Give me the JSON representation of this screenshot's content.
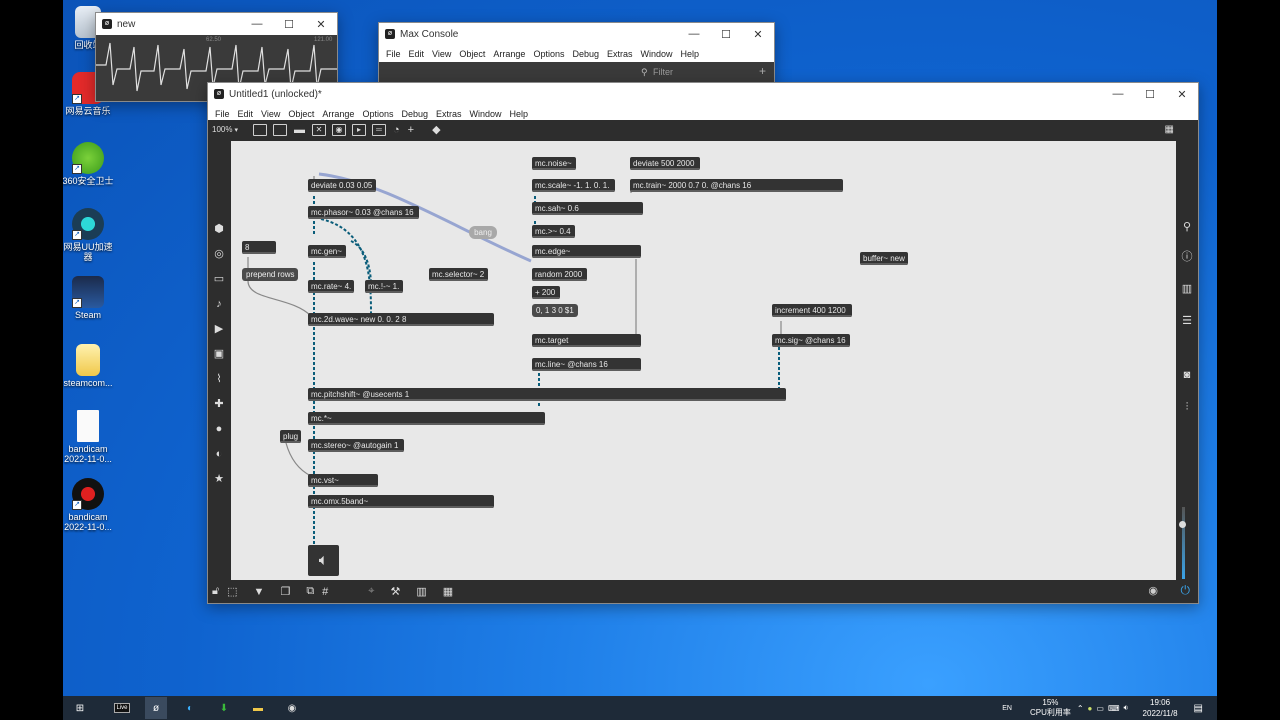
{
  "desktop": {
    "icons": [
      {
        "label": "回收站",
        "icon": "recycle-bin-icon"
      },
      {
        "label": "网易云音乐",
        "icon": "netease-music-icon"
      },
      {
        "label": "360安全卫士",
        "icon": "360-security-icon"
      },
      {
        "label": "网易UU加速器",
        "icon": "uu-accelerator-icon"
      },
      {
        "label": "Steam",
        "icon": "steam-icon"
      },
      {
        "label": "steamcom...",
        "icon": "folder-icon"
      },
      {
        "label": "bandicam 2022-11-0...",
        "icon": "document-icon"
      },
      {
        "label": "bandicam 2022-11-0...",
        "icon": "bandicam-icon"
      }
    ]
  },
  "scope_window": {
    "title": "new",
    "ticks": [
      "62.50",
      "121.00"
    ]
  },
  "console_window": {
    "title": "Max Console",
    "menu": [
      "File",
      "Edit",
      "View",
      "Object",
      "Arrange",
      "Options",
      "Debug",
      "Extras",
      "Window",
      "Help"
    ],
    "filter_placeholder": "Filter",
    "add_label": "+"
  },
  "patcher_window": {
    "title": "Untitled1 (unlocked)*",
    "menu": [
      "File",
      "Edit",
      "View",
      "Object",
      "Arrange",
      "Options",
      "Debug",
      "Extras",
      "Window",
      "Help"
    ],
    "zoom": "100%",
    "objects": {
      "deviate1": "deviate 0.03 0.05",
      "phasor": "mc.phasor~ 0.03 @chans 16",
      "bang": "bang",
      "num8": "8",
      "prepend": "prepend rows",
      "gen": "mc.gen~",
      "rate": "mc.rate~ 4.",
      "not": "mc.!-~ 1.",
      "selector": "mc.selector~ 2",
      "wave": "mc.2d.wave~ new 0. 0. 2 8",
      "noise": "mc.noise~",
      "scale": "mc.scale~ -1. 1. 0. 1.",
      "sah": "mc.sah~ 0.6",
      "gt": "mc.>~ 0.4",
      "edge": "mc.edge~",
      "random": "random 2000",
      "plus": "+ 200",
      "msg013": "0, 1 3 0 $1",
      "target": "mc.target",
      "line": "mc.line~ @chans 16",
      "deviate2": "deviate 500 2000",
      "train": "mc.train~ 2000 0.7 0. @chans 16",
      "buffer": "buffer~ new",
      "increment": "increment 400 1200",
      "sig": "mc.sig~ @chans 16",
      "pitchshift": "mc.pitchshift~ @usecents 1",
      "mult": "mc.*~",
      "plug": "plug",
      "stereo": "mc.stereo~ @autogain 1",
      "vst": "mc.vst~",
      "omx": "mc.omx.5band~"
    }
  },
  "taskbar": {
    "tray_lang": "EN",
    "cpu_percent": "15%",
    "cpu_label": "CPU利用率",
    "time": "19:06",
    "date": "2022/11/8"
  }
}
